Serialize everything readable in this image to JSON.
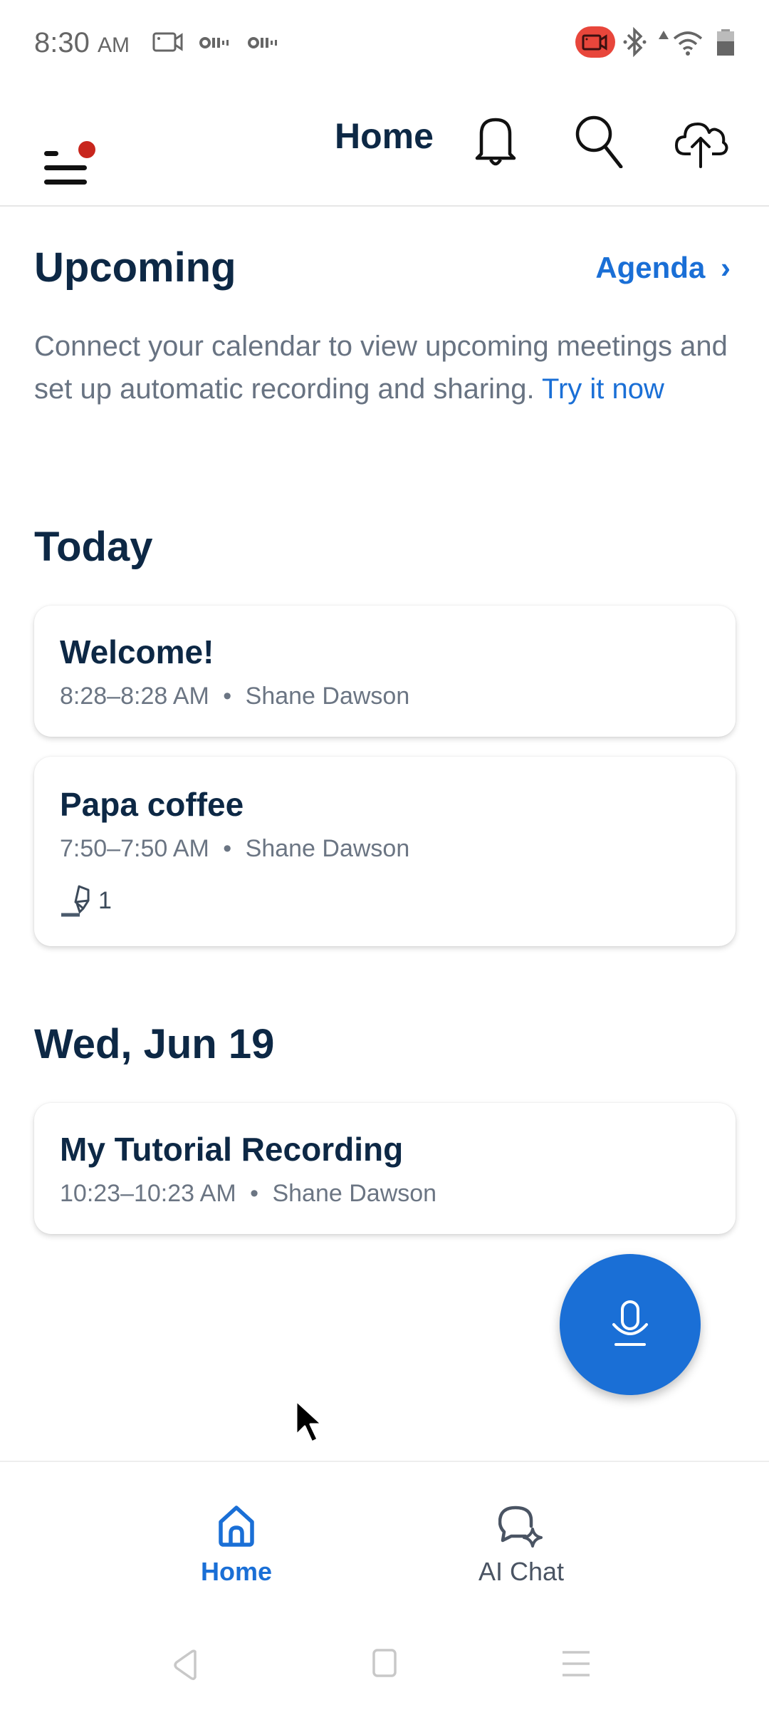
{
  "status_bar": {
    "time": "8:30",
    "ampm": "AM",
    "icons": [
      "screen-record-icon",
      "voicemail-icon",
      "voicemail-icon",
      "recording-active-icon",
      "bluetooth-icon",
      "data-arrow-icon",
      "wifi-icon",
      "battery-icon"
    ]
  },
  "header": {
    "title": "Home",
    "menu_icon": "hamburger-menu-icon",
    "has_notification_dot": true,
    "actions": [
      "bell-icon",
      "search-icon",
      "cloud-upload-icon"
    ]
  },
  "upcoming": {
    "title": "Upcoming",
    "agenda_link": "Agenda",
    "agenda_chevron": "›",
    "description": "Connect your calendar to view upcoming meetings and set up automatic recording and sharing. ",
    "cta": "Try it now"
  },
  "sections": [
    {
      "title": "Today",
      "items": [
        {
          "title": "Welcome!",
          "time": "8:28–8:28 AM",
          "separator": "•",
          "owner": "Shane Dawson"
        },
        {
          "title": "Papa coffee",
          "time": "7:50–7:50 AM",
          "separator": "•",
          "owner": "Shane Dawson",
          "highlight_count": "1"
        }
      ]
    },
    {
      "title": "Wed, Jun 19",
      "items": [
        {
          "title": "My Tutorial Recording",
          "time": "10:23–10:23 AM",
          "separator": "•",
          "owner": "Shane Dawson"
        }
      ]
    }
  ],
  "fab": {
    "icon": "microphone-icon"
  },
  "bottom_nav": {
    "items": [
      {
        "label": "Home",
        "icon": "home-icon",
        "active": true
      },
      {
        "label": "AI Chat",
        "icon": "ai-chat-icon",
        "active": false
      }
    ]
  },
  "colors": {
    "accent": "#1a6fd6",
    "heading": "#0d2845",
    "muted": "#687382",
    "notification": "#c8261d",
    "recording": "#e8463b"
  }
}
